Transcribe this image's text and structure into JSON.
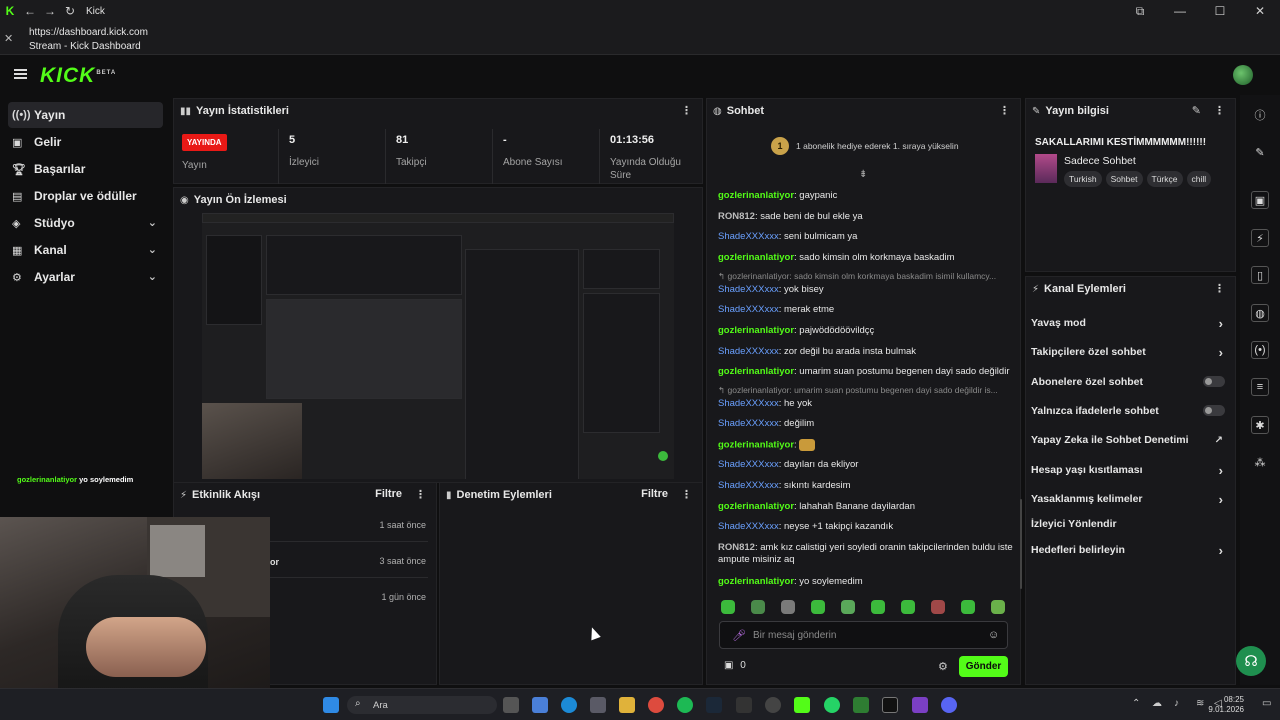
{
  "window": {
    "title": "Kick"
  },
  "urlbar": {
    "url": "https://dashboard.kick.com",
    "page_title": "Stream - Kick Dashboard"
  },
  "brand": {
    "logo": "KICK",
    "logo_mark": "BETA",
    "accent": "#53fc18"
  },
  "sidebar": {
    "items": [
      {
        "label": "Yayın",
        "icon": "broadcast-icon"
      },
      {
        "label": "Gelir",
        "icon": "revenue-icon"
      },
      {
        "label": "Başarılar",
        "icon": "trophy-icon"
      },
      {
        "label": "Droplar ve ödüller",
        "icon": "gift-icon"
      },
      {
        "label": "Stüdyo",
        "icon": "studio-icon"
      },
      {
        "label": "Kanal",
        "icon": "channel-icon"
      },
      {
        "label": "Ayarlar",
        "icon": "gear-icon"
      }
    ]
  },
  "stats": {
    "title": "Yayın İstatistikleri",
    "live_badge": "YAYINDA",
    "live_label": "Yayın",
    "viewers_value": "5",
    "viewers_label": "İzleyici",
    "followers_value": "81",
    "followers_label": "Takipçi",
    "subs_value": "-",
    "subs_label": "Abone Sayısı",
    "duration_value": "01:13:56",
    "duration_label": "Yayında Olduğu Süre"
  },
  "preview": {
    "title": "Yayın Ön İzlemesi"
  },
  "overlay_chat": {
    "name": "gozlerinanlatiyor",
    "text": "yo soylemedim"
  },
  "activity": {
    "title": "Etkinlik Akışı",
    "filter": "Filtre",
    "rows": [
      {
        "text": "",
        "time": "1 saat önce"
      },
      {
        "text": "or",
        "time": "3 saat önce"
      },
      {
        "text": "",
        "time": "1 gün önce"
      }
    ]
  },
  "moderation": {
    "title": "Denetim Eylemleri",
    "filter": "Filtre"
  },
  "chat": {
    "title": "Sohbet",
    "rank_badge": "1",
    "gift_banner": "1 abonelik hediye ederek 1. sıraya yükselin",
    "messages": [
      {
        "user": "gozlerinanlatiyor",
        "text": ": gaypanic",
        "kind": "green"
      },
      {
        "user": "RON812",
        "text": ": sade beni de bul ekle ya",
        "kind": "grey"
      },
      {
        "user": "ShadeXXXxxx",
        "text": ": seni bulmicam ya",
        "kind": "blue"
      },
      {
        "user": "gozlerinanlatiyor",
        "text": ": sado kimsin olm korkmaya baskadim",
        "kind": "green"
      },
      {
        "user": "ShadeXXXxxx",
        "text": ": yok bisey",
        "kind": "blue",
        "reply": "gozlerinanlatiyor: sado kimsin olm korkmaya baskadim isimil kullamcy..."
      },
      {
        "user": "ShadeXXXxxx",
        "text": ": merak etme",
        "kind": "blue"
      },
      {
        "user": "gozlerinanlatiyor",
        "text": ": pajwödödöövildçç",
        "kind": "green"
      },
      {
        "user": "ShadeXXXxxx",
        "text": ": zor değil bu arada insta bulmak",
        "kind": "blue"
      },
      {
        "user": "gozlerinanlatiyor",
        "text": ": umarim suan postumu begenen dayi sado değildir",
        "kind": "green"
      },
      {
        "user": "ShadeXXXxxx",
        "text": ": he yok",
        "kind": "blue",
        "reply": "gozlerinanlatiyor: umarim suan postumu begenen dayi sado değildir is..."
      },
      {
        "user": "ShadeXXXxxx",
        "text": ": değilim",
        "kind": "blue"
      },
      {
        "user": "gozlerinanlatiyor",
        "text": ":",
        "kind": "green"
      },
      {
        "user": "ShadeXXXxxx",
        "text": ": dayıları da ekliyor",
        "kind": "blue"
      },
      {
        "user": "ShadeXXXxxx",
        "text": ": sıkıntı kardesim",
        "kind": "blue"
      },
      {
        "user": "gozlerinanlatiyor",
        "text": ": lahahah Banane dayilardan",
        "kind": "green"
      },
      {
        "user": "ShadeXXXxxx",
        "text": ": neyse +1 takipçi kazandık",
        "kind": "blue"
      },
      {
        "user": "RON812",
        "text": ": amk kız calistigi yeri soyledi oranin takipcilerinden buldu iste ampute misiniz aq",
        "kind": "grey"
      },
      {
        "user": "gozlerinanlatiyor",
        "text": ": yo soylemedim",
        "kind": "green"
      }
    ],
    "input_placeholder": "Bir mesaj gönderin",
    "points": "0",
    "send": "Gönder"
  },
  "stream_info": {
    "title": "Yayın bilgisi",
    "stream_title": "SAKALLARIMI KESTİMMMMMM!!!!!!",
    "category": "Sadece Sohbet",
    "tags": [
      "Turkish",
      "Sohbet",
      "Türkçe",
      "chill"
    ]
  },
  "channel_actions": {
    "title": "Kanal Eylemleri",
    "items": [
      {
        "label": "Yavaş mod",
        "control": "chevron"
      },
      {
        "label": "Takipçilere özel sohbet",
        "control": "chevron"
      },
      {
        "label": "Abonelere özel sohbet",
        "control": "toggle"
      },
      {
        "label": "Yalnızca ifadelerle sohbet",
        "control": "toggle"
      },
      {
        "label": "Yapay Zeka ile Sohbet Denetimi",
        "control": "external"
      },
      {
        "label": "Hesap yaşı kısıtlaması",
        "control": "chevron"
      },
      {
        "label": "Yasaklanmış kelimeler",
        "control": "chevron"
      },
      {
        "label": "İzleyici Yönlendir",
        "control": "none"
      },
      {
        "label": "Hedefleri belirleyin",
        "control": "chevron"
      }
    ]
  },
  "taskbar": {
    "search": "Ara",
    "time": "08:25",
    "date": "9.01.2026"
  }
}
